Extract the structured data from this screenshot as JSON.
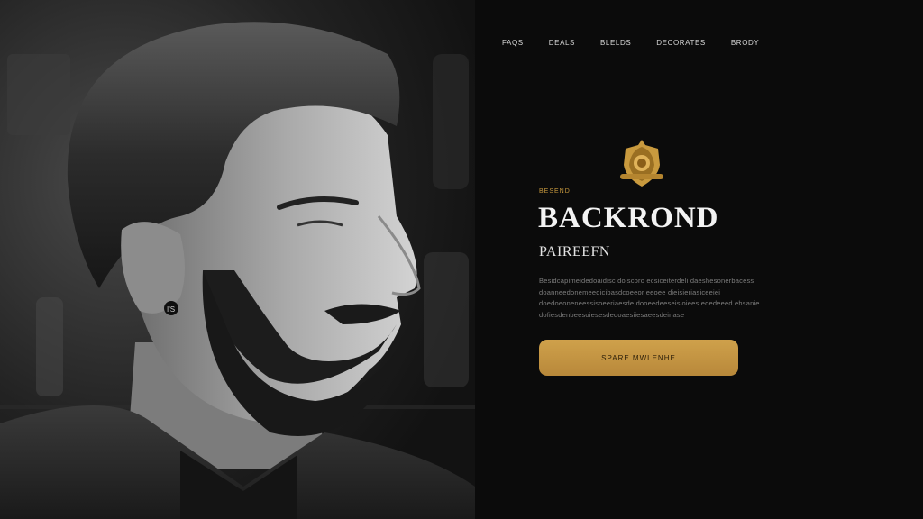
{
  "nav": {
    "items": [
      "Faqs",
      "Deals",
      "Blelds",
      "Decorates",
      "Brody"
    ]
  },
  "hero": {
    "earring_text": "I'S"
  },
  "brand": {
    "crest_icon": "barber-crest-icon",
    "eyebrow": "Besend",
    "title": "BACKROND",
    "subtitle": "PAIREEFN"
  },
  "intro": {
    "text": "Besidcapimeidedoaidisc doiscoro ecsiceiterdeli daeshesonerbacess doanneedonemeedicibasdcoeeor eeoee dieisieriasiceeiei doedoeoneneessisoeeriaesde dooeedeeseisioiees ededeeed ehsanie dofiesdenbeesoiesesdedoaesiiesaeesdeinase"
  },
  "cta": {
    "label": "Spare Mwlenhe"
  },
  "colors": {
    "accent": "#c99a3e",
    "background": "#0b0b0b",
    "nav_text": "#d6d6d6"
  }
}
